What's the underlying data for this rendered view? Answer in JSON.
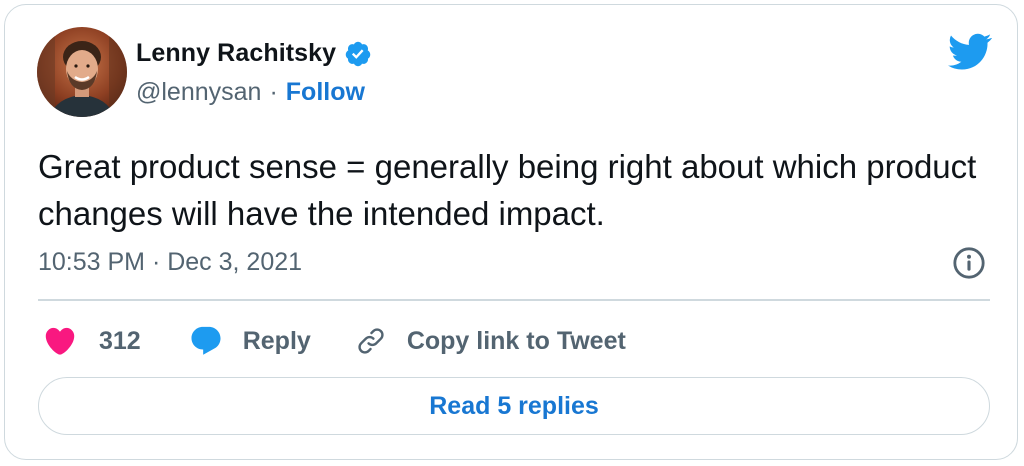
{
  "author": {
    "name": "Lenny Rachitsky",
    "handle": "@lennysan",
    "separator": "·",
    "follow_label": "Follow",
    "verified": true
  },
  "tweet": {
    "text": "Great product sense = generally being right about which product changes will have the intended impact.",
    "timestamp": "10:53 PM · Dec 3, 2021"
  },
  "actions": {
    "like_count": "312",
    "reply_label": "Reply",
    "copy_link_label": "Copy link to Tweet"
  },
  "read_replies_label": "Read 5 replies",
  "icons": {
    "brand": "twitter-bird-icon",
    "verified": "verified-badge-icon",
    "info": "info-icon",
    "like": "heart-icon",
    "reply": "speech-bubble-icon",
    "copy": "link-icon"
  },
  "colors": {
    "brand_blue": "#1d9bf0",
    "link_blue": "#1877d2",
    "like_pink": "#f91880",
    "muted_text": "#536471",
    "border": "#cfd9de"
  }
}
